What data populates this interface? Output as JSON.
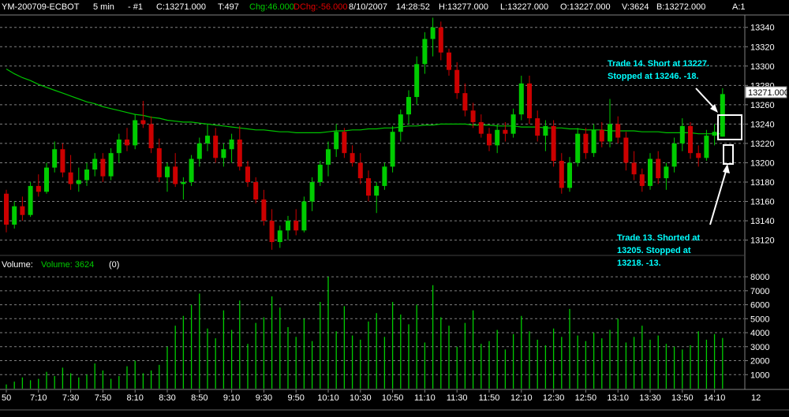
{
  "header": {
    "symbol": "YM-200709-ECBOT",
    "interval": "5 min",
    "chart_no": "- #1",
    "close": "C:13271.000",
    "ticks": "T:497",
    "chg": "Chg:46.000",
    "dchg": "DChg:-56.000",
    "date": "8/10/2007",
    "time": "14:28:52",
    "high": "H:13277.000",
    "low": "L:13227.000",
    "open": "O:13227.000",
    "volume": "V:3624",
    "last": "B:13272.000",
    "cut": "A:1"
  },
  "volume_header": {
    "label": "Volume:",
    "series": "Volume: 3624",
    "zero": "(0)"
  },
  "last_price_label": "13271.000",
  "annotations": [
    {
      "lines": [
        "Trade 14.  Short at 13227.",
        "Stopped at 13246.  -18."
      ]
    },
    {
      "lines": [
        "Trade 13.  Shorted at",
        "13205.  Stopped at",
        "13218.  -13."
      ]
    }
  ],
  "chart_data": [
    {
      "type": "candlestick",
      "title": "YM-200709-ECBOT 5 min",
      "ylim": [
        13105,
        13352
      ],
      "y_ticks": [
        13120,
        13140,
        13160,
        13180,
        13200,
        13220,
        13240,
        13260,
        13280,
        13300,
        13320,
        13340
      ],
      "x_ticks": [
        "50",
        "7:10",
        "7:30",
        "7:50",
        "8:10",
        "8:30",
        "8:50",
        "9:10",
        "9:30",
        "9:50",
        "10:10",
        "10:30",
        "10:50",
        "11:10",
        "11:30",
        "11:50",
        "12:10",
        "12:30",
        "12:50",
        "13:10",
        "13:30",
        "13:50",
        "14:10"
      ],
      "x_tick_bar_index": [
        0,
        4,
        8,
        12,
        16,
        20,
        24,
        28,
        32,
        36,
        40,
        44,
        48,
        52,
        56,
        60,
        64,
        68,
        72,
        76,
        80,
        84,
        88
      ],
      "x_axis_end_label": "12",
      "grid": true,
      "colors": {
        "up": "#00cc00",
        "down": "#cc0000",
        "moving_average": "#00c400",
        "grid": "#808080"
      },
      "ohlc": [
        [
          13168,
          13172,
          13128,
          13136
        ],
        [
          13136,
          13160,
          13132,
          13155
        ],
        [
          13155,
          13165,
          13140,
          13146
        ],
        [
          13146,
          13180,
          13144,
          13176
        ],
        [
          13176,
          13188,
          13165,
          13170
        ],
        [
          13170,
          13200,
          13168,
          13195
        ],
        [
          13195,
          13222,
          13190,
          13214
        ],
        [
          13214,
          13220,
          13185,
          13190
        ],
        [
          13190,
          13208,
          13172,
          13178
        ],
        [
          13178,
          13195,
          13170,
          13182
        ],
        [
          13182,
          13200,
          13176,
          13193
        ],
        [
          13193,
          13210,
          13186,
          13204
        ],
        [
          13204,
          13210,
          13180,
          13186
        ],
        [
          13186,
          13215,
          13182,
          13210
        ],
        [
          13210,
          13230,
          13200,
          13224
        ],
        [
          13224,
          13236,
          13212,
          13218
        ],
        [
          13218,
          13250,
          13214,
          13244
        ],
        [
          13244,
          13264,
          13236,
          13240
        ],
        [
          13240,
          13248,
          13210,
          13215
        ],
        [
          13215,
          13225,
          13180,
          13185
        ],
        [
          13185,
          13200,
          13170,
          13196
        ],
        [
          13196,
          13210,
          13175,
          13178
        ],
        [
          13178,
          13185,
          13162,
          13180
        ],
        [
          13180,
          13208,
          13176,
          13204
        ],
        [
          13204,
          13226,
          13196,
          13220
        ],
        [
          13220,
          13240,
          13212,
          13228
        ],
        [
          13228,
          13236,
          13200,
          13205
        ],
        [
          13205,
          13220,
          13196,
          13214
        ],
        [
          13214,
          13230,
          13200,
          13224
        ],
        [
          13224,
          13238,
          13192,
          13196
        ],
        [
          13196,
          13202,
          13175,
          13180
        ],
        [
          13180,
          13185,
          13158,
          13162
        ],
        [
          13162,
          13172,
          13135,
          13140
        ],
        [
          13140,
          13152,
          13110,
          13118
        ],
        [
          13118,
          13135,
          13112,
          13130
        ],
        [
          13130,
          13145,
          13120,
          13140
        ],
        [
          13140,
          13152,
          13125,
          13130
        ],
        [
          13130,
          13165,
          13128,
          13160
        ],
        [
          13160,
          13185,
          13150,
          13180
        ],
        [
          13180,
          13202,
          13176,
          13198
        ],
        [
          13198,
          13222,
          13186,
          13214
        ],
        [
          13214,
          13240,
          13206,
          13232
        ],
        [
          13232,
          13236,
          13205,
          13210
        ],
        [
          13210,
          13218,
          13196,
          13200
        ],
        [
          13200,
          13210,
          13178,
          13184
        ],
        [
          13184,
          13192,
          13160,
          13166
        ],
        [
          13166,
          13180,
          13148,
          13176
        ],
        [
          13176,
          13200,
          13172,
          13196
        ],
        [
          13196,
          13238,
          13190,
          13232
        ],
        [
          13232,
          13255,
          13222,
          13250
        ],
        [
          13250,
          13275,
          13240,
          13268
        ],
        [
          13268,
          13310,
          13260,
          13302
        ],
        [
          13302,
          13335,
          13292,
          13328
        ],
        [
          13328,
          13350,
          13310,
          13340
        ],
        [
          13340,
          13346,
          13306,
          13314
        ],
        [
          13314,
          13318,
          13290,
          13296
        ],
        [
          13296,
          13304,
          13266,
          13272
        ],
        [
          13272,
          13282,
          13248,
          13254
        ],
        [
          13254,
          13262,
          13236,
          13242
        ],
        [
          13242,
          13250,
          13226,
          13230
        ],
        [
          13230,
          13236,
          13212,
          13218
        ],
        [
          13218,
          13240,
          13210,
          13234
        ],
        [
          13234,
          13242,
          13222,
          13230
        ],
        [
          13230,
          13256,
          13226,
          13250
        ],
        [
          13250,
          13290,
          13244,
          13282
        ],
        [
          13282,
          13290,
          13240,
          13246
        ],
        [
          13246,
          13254,
          13222,
          13228
        ],
        [
          13228,
          13244,
          13212,
          13238
        ],
        [
          13238,
          13244,
          13196,
          13202
        ],
        [
          13202,
          13210,
          13168,
          13174
        ],
        [
          13174,
          13206,
          13170,
          13200
        ],
        [
          13200,
          13236,
          13196,
          13230
        ],
        [
          13230,
          13236,
          13204,
          13210
        ],
        [
          13210,
          13240,
          13206,
          13234
        ],
        [
          13234,
          13242,
          13216,
          13222
        ],
        [
          13222,
          13266,
          13216,
          13240
        ],
        [
          13240,
          13248,
          13220,
          13226
        ],
        [
          13226,
          13232,
          13192,
          13200
        ],
        [
          13200,
          13212,
          13182,
          13188
        ],
        [
          13188,
          13194,
          13170,
          13176
        ],
        [
          13176,
          13210,
          13172,
          13204
        ],
        [
          13204,
          13212,
          13178,
          13184
        ],
        [
          13184,
          13200,
          13172,
          13196
        ],
        [
          13196,
          13226,
          13190,
          13220
        ],
        [
          13220,
          13246,
          13212,
          13238
        ],
        [
          13238,
          13242,
          13204,
          13210
        ],
        [
          13210,
          13218,
          13196,
          13205
        ],
        [
          13205,
          13234,
          13202,
          13228
        ],
        [
          13228,
          13240,
          13218,
          13232
        ],
        [
          13227,
          13277,
          13227,
          13271
        ]
      ],
      "moving_average": [
        13297,
        13292,
        13288,
        13285,
        13281,
        13278,
        13275,
        13272,
        13269,
        13266,
        13263,
        13261,
        13258,
        13256,
        13254,
        13252,
        13250,
        13249,
        13247,
        13246,
        13244,
        13243,
        13242,
        13242,
        13241,
        13240,
        13239,
        13238,
        13237,
        13236,
        13235,
        13234,
        13234,
        13233,
        13232,
        13232,
        13231,
        13231,
        13231,
        13231,
        13232,
        13233,
        13233,
        13234,
        13234,
        13235,
        13235,
        13236,
        13236,
        13237,
        13238,
        13238,
        13239,
        13239,
        13240,
        13240,
        13240,
        13240,
        13239,
        13239,
        13239,
        13238,
        13238,
        13238,
        13237,
        13237,
        13237,
        13236,
        13236,
        13236,
        13235,
        13235,
        13234,
        13234,
        13234,
        13233,
        13233,
        13233,
        13233,
        13232,
        13232,
        13232,
        13231,
        13231,
        13231,
        13231,
        13230,
        13230,
        13230,
        13230
      ]
    },
    {
      "type": "bar",
      "title": "Volume",
      "series": [
        {
          "name": "Volume",
          "values": [
            300,
            500,
            800,
            600,
            700,
            1200,
            900,
            1500,
            1100,
            800,
            1000,
            1800,
            1300,
            700,
            900,
            1600,
            2000,
            1100,
            1300,
            1700,
            3000,
            4500,
            5200,
            6000,
            6800,
            4300,
            3600,
            5600,
            4200,
            6300,
            3200,
            4700,
            5100,
            6600,
            5800,
            4400,
            3700,
            5000,
            3400,
            6200,
            8000,
            4100,
            5900,
            3800,
            3500,
            4800,
            5400,
            3700,
            6200,
            5300,
            4600,
            6000,
            3300,
            7400,
            5100,
            4500,
            3000,
            4700,
            5600,
            3200,
            3400,
            4200,
            2800,
            3900,
            5200,
            4100,
            3500,
            3100,
            4300,
            3700,
            5700,
            3800,
            3400,
            4000,
            3600,
            4200,
            5000,
            3300,
            3700,
            4500,
            3500,
            3800,
            3200,
            3000,
            2800,
            3100,
            4100,
            3500,
            3900,
            3624
          ]
        }
      ],
      "ylim": [
        0,
        8400
      ],
      "y_ticks": [
        1000,
        2000,
        3000,
        4000,
        5000,
        6000,
        7000,
        8000
      ]
    }
  ]
}
